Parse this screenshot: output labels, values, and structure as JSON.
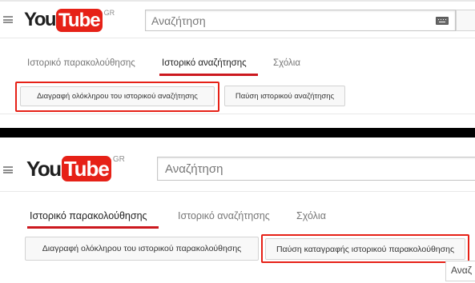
{
  "screens": [
    {
      "logo": {
        "you": "You",
        "tube": "Tube",
        "country": "GR"
      },
      "search": {
        "placeholder": "Αναζήτηση",
        "keyboard_icon": "keyboard-icon"
      },
      "tabs": [
        {
          "label": "Ιστορικό παρακολούθησης",
          "active": false
        },
        {
          "label": "Ιστορικό αναζήτησης",
          "active": true
        },
        {
          "label": "Σχόλια",
          "active": false
        }
      ],
      "buttons": {
        "clear": "Διαγραφή ολόκληρου του ιστορικού αναζήτησης",
        "pause": "Παύση ιστορικού αναζήτησης"
      }
    },
    {
      "logo": {
        "you": "You",
        "tube": "Tube",
        "country": "GR"
      },
      "search": {
        "placeholder": "Αναζήτηση"
      },
      "tabs": [
        {
          "label": "Ιστορικό παρακολούθησης",
          "active": true
        },
        {
          "label": "Ιστορικό αναζήτησης",
          "active": false
        },
        {
          "label": "Σχόλια",
          "active": false
        }
      ],
      "buttons": {
        "clear": "Διαγραφή ολόκληρου του ιστορικού παρακολούθησης",
        "pause": "Παύση καταγραφής ιστορικού παρακολούθησης"
      },
      "search_peek": "Αναζ"
    }
  ],
  "colors": {
    "accent_red": "#e62117",
    "tab_underline": "#cc181e",
    "divider": "#000000"
  }
}
